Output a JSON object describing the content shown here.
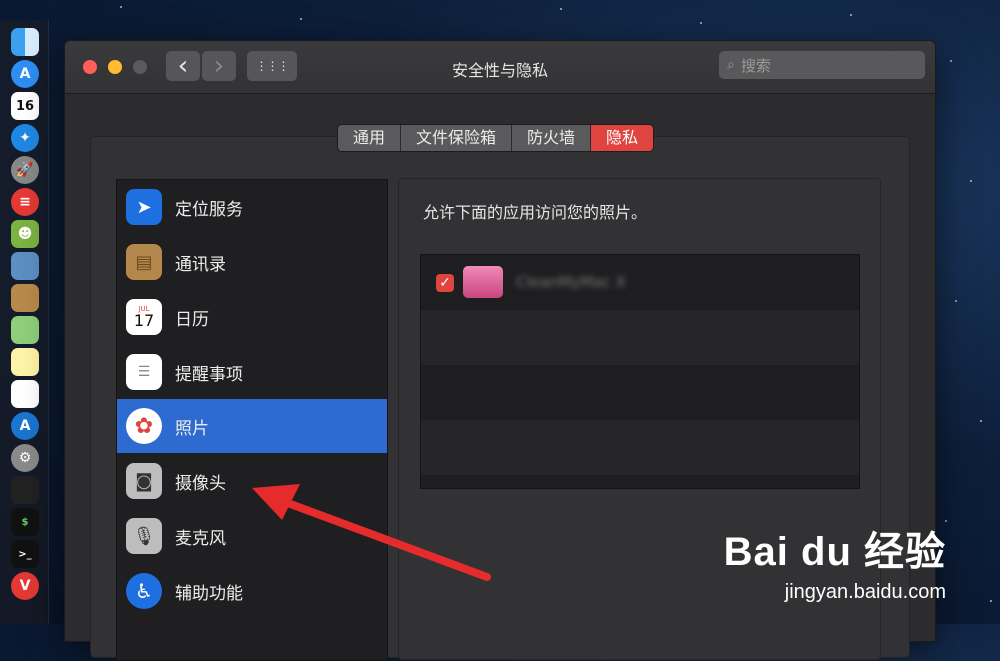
{
  "window": {
    "title": "安全性与隐私",
    "search_placeholder": "搜索",
    "back_glyph": "‹",
    "forward_glyph": "›",
    "grid_glyph": "⋮⋮⋮"
  },
  "tabs": [
    {
      "label": "通用",
      "active": false
    },
    {
      "label": "文件保险箱",
      "active": false
    },
    {
      "label": "防火墙",
      "active": false
    },
    {
      "label": "隐私",
      "active": true
    }
  ],
  "sidebar": {
    "items": [
      {
        "label": "定位服务",
        "icon": "location-arrow-icon",
        "selected": false
      },
      {
        "label": "通讯录",
        "icon": "contacts-book-icon",
        "selected": false
      },
      {
        "label": "日历",
        "icon": "calendar-icon",
        "calendar_month": "JUL",
        "calendar_day": "17",
        "selected": false
      },
      {
        "label": "提醒事项",
        "icon": "reminders-icon",
        "selected": false
      },
      {
        "label": "照片",
        "icon": "photos-icon",
        "selected": true
      },
      {
        "label": "摄像头",
        "icon": "camera-icon",
        "selected": false
      },
      {
        "label": "麦克风",
        "icon": "microphone-icon",
        "selected": false
      },
      {
        "label": "辅助功能",
        "icon": "accessibility-icon",
        "selected": false
      }
    ]
  },
  "content": {
    "description": "允许下面的应用访问您的照片。",
    "apps": [
      {
        "name": "CleanMyMac X",
        "checked": true
      }
    ]
  },
  "dock": {
    "calendar_day": "16"
  },
  "watermark": {
    "logo": "Bai du 经验",
    "url": "jingyan.baidu.com"
  },
  "colors": {
    "accent_red": "#e0443e",
    "selection_blue": "#2d6bd0",
    "arrow_red": "#e52b2b"
  }
}
